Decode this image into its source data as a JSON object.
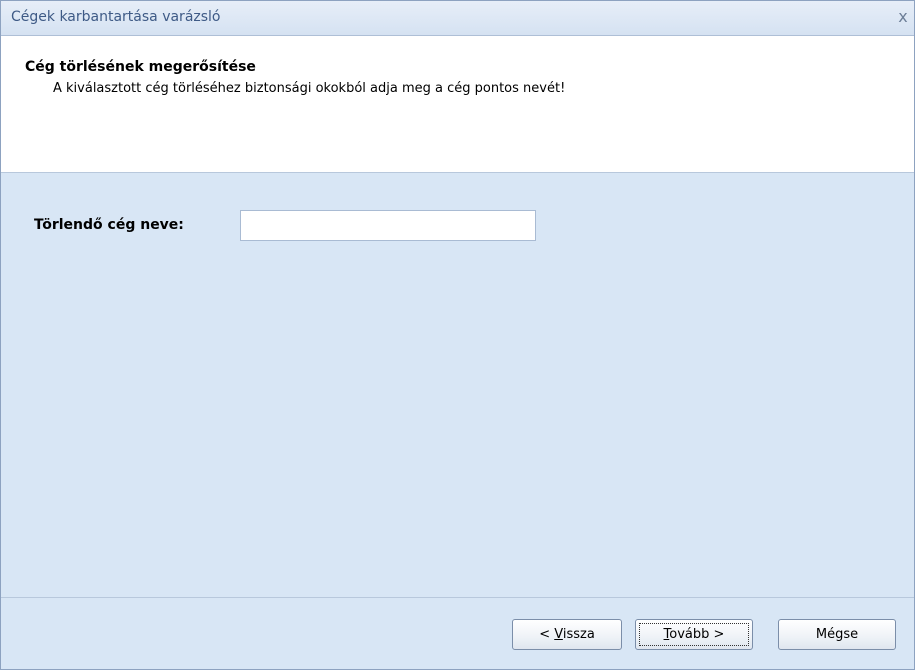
{
  "window": {
    "title": "Cégek karbantartása varázsló",
    "close_glyph": "x"
  },
  "header": {
    "title": "Cég törlésének megerősítése",
    "description": "A kiválasztott cég törléséhez biztonsági okokból adja meg a cég pontos nevét!"
  },
  "form": {
    "company_name_label": "Törlendő cég neve:",
    "company_name_value": "",
    "company_name_placeholder": ""
  },
  "buttons": {
    "back_prefix": "< ",
    "back_accel": "V",
    "back_rest": "issza",
    "next_accel": "T",
    "next_rest": "ovább >",
    "cancel_label": "Mégse"
  },
  "colors": {
    "panel_background": "#d8e6f5",
    "header_background": "#ffffff",
    "title_text": "#3e5a86"
  }
}
